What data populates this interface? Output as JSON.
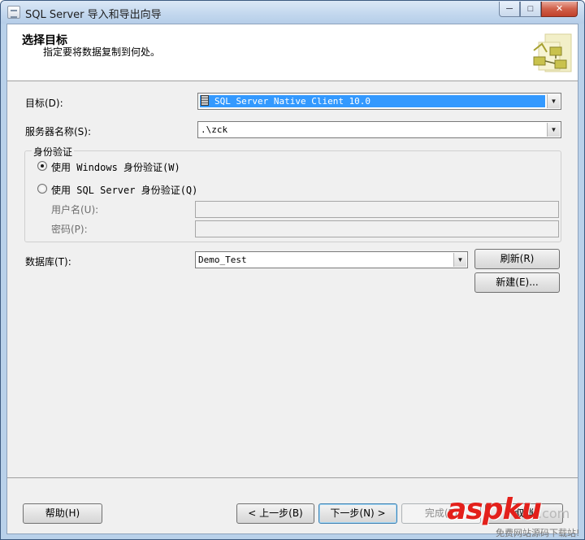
{
  "window": {
    "title": "SQL Server 导入和导出向导",
    "controls": {
      "minimize": "─",
      "maximize": "□",
      "close": "✕"
    }
  },
  "header": {
    "title": "选择目标",
    "subtitle": "指定要将数据复制到何处。",
    "graphic_icon": "wizard-flow-icon"
  },
  "form": {
    "target_label": "目标(D):",
    "target_value": "SQL Server Native Client 10.0",
    "server_label": "服务器名称(S):",
    "server_value": ".\\zck",
    "auth_group_title": "身份验证",
    "auth_windows_label": "使用 Windows 身份验证(W)",
    "auth_sql_label": "使用 SQL Server 身份验证(Q)",
    "auth_selected": "windows",
    "username_label": "用户名(U):",
    "username_value": "",
    "password_label": "密码(P):",
    "password_value": "",
    "database_label": "数据库(T):",
    "database_value": "Demo_Test",
    "refresh_button": "刷新(R)",
    "new_button": "新建(E)..."
  },
  "footer": {
    "help_button": "帮助(H)",
    "back_button": "< 上一步(B)",
    "next_button": "下一步(N) >",
    "finish_button": "完成(F)",
    "cancel_button": "取消"
  },
  "watermark": {
    "brand": "aspku",
    "suffix": ".com",
    "tagline": "免费网站源码下载站!"
  },
  "colors": {
    "titlebar": "#c2d7ee",
    "selection": "#3399ff",
    "watermark_red": "#e3201b"
  }
}
